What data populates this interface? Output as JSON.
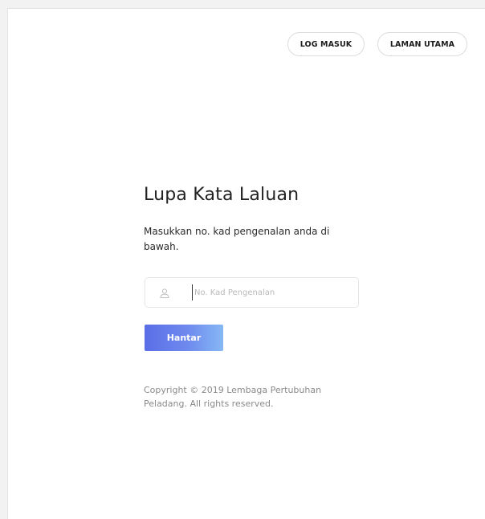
{
  "nav": {
    "login_label": "LOG MASUK",
    "home_label": "LAMAN UTAMA"
  },
  "page": {
    "title": "Lupa Kata Laluan",
    "description": "Masukkan no. kad pengenalan anda di bawah."
  },
  "form": {
    "ic_field": {
      "placeholder": "No. Kad Pengenalan",
      "value": "",
      "icon": "user-icon"
    },
    "submit_label": "Hantar"
  },
  "footer": {
    "copyright": "Copyright © 2019 Lembaga Pertubuhan Peladang. All rights reserved."
  },
  "colors": {
    "accent_start": "#5a6ee6",
    "accent_end": "#86b8f5",
    "text_dark": "#222222",
    "text_muted": "#8a8a8a"
  }
}
